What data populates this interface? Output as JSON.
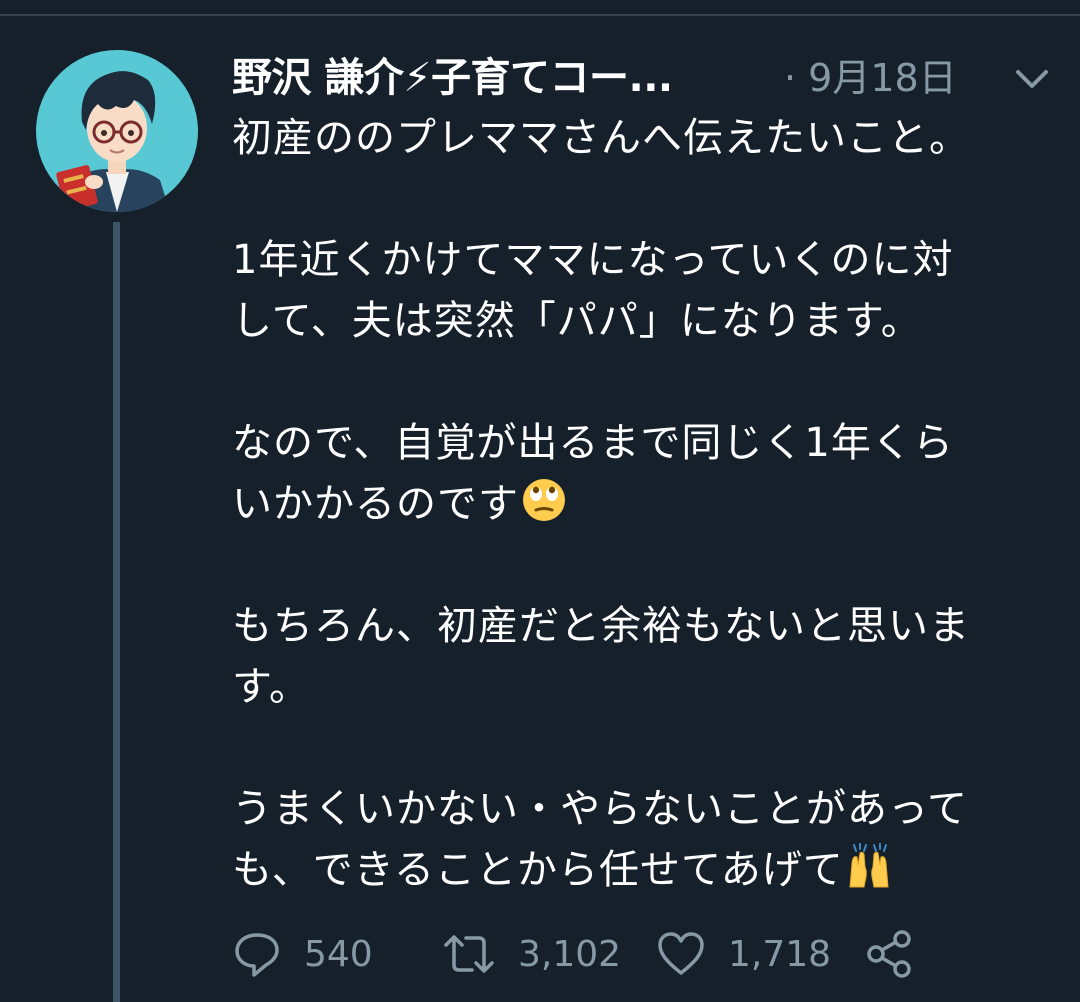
{
  "tweet": {
    "author": {
      "display_name": "野沢 謙介⚡子育てコー...",
      "avatar_icon": "avatar-illustration-glasses-man"
    },
    "date": "· 9月18日",
    "menu_icon": "chevron-down-icon",
    "body": [
      "初産ののプレママさんへ伝えたいこと。",
      "1年近くかけてママになっていくのに対\nして、夫は突然「パパ」になります。",
      "なので、自覚が出るまで同じく1年くら\nいかかるのです",
      "もちろん、初産だと余裕もないと思いま\nす。",
      "うまくいかない・やらないことがあって\nも、できることから任せてあげて"
    ],
    "emojis": [
      "face-with-rolling-eyes-emoji",
      "raising-hands-emoji"
    ],
    "actions": {
      "reply": {
        "icon": "reply-icon",
        "count": "540"
      },
      "retweet": {
        "icon": "retweet-icon",
        "count": "3,102"
      },
      "like": {
        "icon": "heart-icon",
        "count": "1,718"
      },
      "share": {
        "icon": "share-icon"
      }
    }
  },
  "colors": {
    "background": "#15202b",
    "text": "#ffffff",
    "secondary_text": "#8899a6",
    "thread_line": "#3d5466",
    "avatar_bg": "#58c9d4"
  }
}
